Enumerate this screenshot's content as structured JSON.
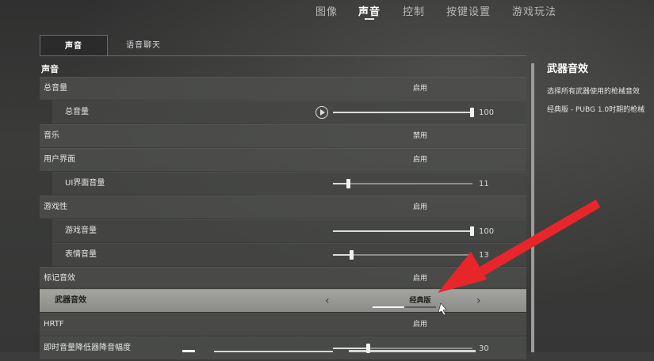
{
  "top_nav": {
    "tabs": [
      "图像",
      "声音",
      "控制",
      "按键设置",
      "游戏玩法"
    ],
    "active_index": 1
  },
  "sub_tabs": [
    "声音",
    "语音聊天"
  ],
  "section_title": "声音",
  "rows": {
    "r0": {
      "label": "总音量",
      "value": "启用"
    },
    "r1": {
      "label": "总音量",
      "number": "100",
      "level": 1.0
    },
    "r2": {
      "label": "音乐",
      "value": "禁用"
    },
    "r3": {
      "label": "用户界面",
      "value": "启用"
    },
    "r4": {
      "label": "UI界面音量",
      "number": "11",
      "level": 0.11
    },
    "r5": {
      "label": "游戏性",
      "value": "启用"
    },
    "r6": {
      "label": "游戏音量",
      "number": "100",
      "level": 1.0
    },
    "r7": {
      "label": "表情音量",
      "number": "13",
      "level": 0.13
    },
    "r8": {
      "label": "标记音效",
      "value": "启用"
    },
    "r9": {
      "label": "武器音效",
      "value": "经典版",
      "prev": "‹",
      "next": "›"
    },
    "r10": {
      "label": "HRTF",
      "value": "启用"
    },
    "r11": {
      "label": "即时音量降低器降音幅度",
      "number": "30",
      "level": 0.25
    }
  },
  "right_panel": {
    "title": "武器音效",
    "line1": "选择所有武器使用的枪械音效",
    "line2": "经典版 - PUBG 1.0时期的枪械"
  },
  "colors": {
    "annotation_arrow": "#e8262a",
    "highlight_row": "#9a9b97"
  }
}
